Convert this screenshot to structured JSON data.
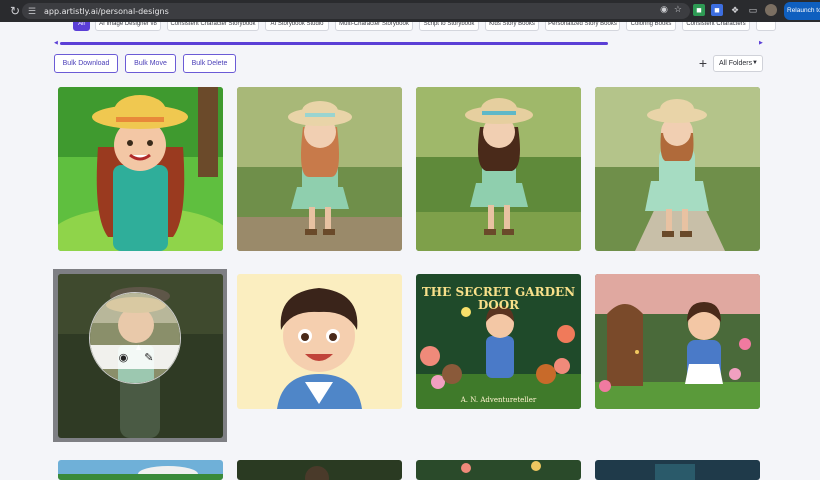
{
  "browser": {
    "url": "app.artistly.ai/personal-designs",
    "relaunch_label": "Relaunch to"
  },
  "categories": [
    {
      "label": "All",
      "active": true
    },
    {
      "label": "AI Image Designer v8",
      "active": false
    },
    {
      "label": "Consistent Character Storybook",
      "active": false
    },
    {
      "label": "AI Storybook Studio",
      "active": false
    },
    {
      "label": "Multi-Character Storybook",
      "active": false
    },
    {
      "label": "Script to Storybook",
      "active": false
    },
    {
      "label": "Kids Story Books",
      "active": false
    },
    {
      "label": "Personalized Story Books",
      "active": false
    },
    {
      "label": "Coloring Books",
      "active": false
    },
    {
      "label": "Consistent Characters",
      "active": false
    }
  ],
  "toolbar": {
    "bulk_download": "Bulk Download",
    "bulk_move": "Bulk Move",
    "bulk_delete": "Bulk Delete",
    "add_icon": "+",
    "folder_select": "All Folders"
  },
  "cards": [
    {
      "name": "cartoon-girl-sunhat",
      "title": "",
      "author": ""
    },
    {
      "name": "photo-girl-path-1",
      "title": "",
      "author": ""
    },
    {
      "name": "photo-girl-path-2",
      "title": "",
      "author": ""
    },
    {
      "name": "photo-girl-path-3",
      "title": "",
      "author": ""
    },
    {
      "name": "hovered-photo-girl",
      "title": "",
      "author": ""
    },
    {
      "name": "cartoon-boy-portrait",
      "title": "",
      "author": ""
    },
    {
      "name": "secret-garden-cover",
      "title": "THE SECRET GARDEN DOOR",
      "author": "A. N. Adventureteller"
    },
    {
      "name": "garden-door-boy",
      "title": "",
      "author": ""
    }
  ],
  "colors": {
    "accent": "#5b3fd6",
    "chrome": "#2a2b2e",
    "background": "#f4f5f9"
  }
}
